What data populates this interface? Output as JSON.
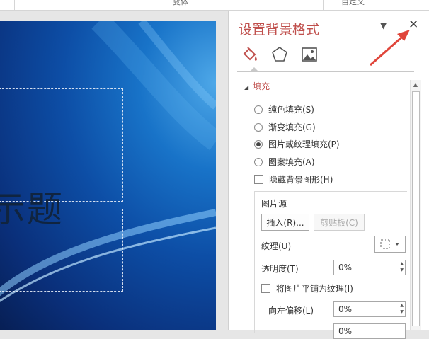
{
  "ribbon": {
    "groups": [
      "变体",
      "自定义"
    ]
  },
  "slide": {
    "title_partial": "示题"
  },
  "pane": {
    "title": "设置背景格式",
    "tabs": [
      "fill-icon",
      "pentagon-icon",
      "picture-icon"
    ],
    "section": "填充",
    "fill_options": [
      {
        "label": "纯色填充(S)",
        "selected": false
      },
      {
        "label": "渐变填充(G)",
        "selected": false
      },
      {
        "label": "图片或纹理填充(P)",
        "selected": true
      },
      {
        "label": "图案填充(A)",
        "selected": false
      }
    ],
    "hide_bg_graphics": "隐藏背景图形(H)",
    "picture_source_label": "图片源",
    "insert_button": "插入(R)...",
    "clipboard_button": "剪贴板(C)",
    "texture_label": "纹理(U)",
    "transparency_label": "透明度(T)",
    "transparency_value": "0%",
    "tile_label": "将图片平铺为纹理(I)",
    "offset_left_label": "向左偏移(L)",
    "offset_left_value": "0%",
    "offset_right_value": "0%"
  },
  "colors": {
    "accent": "#c0504d",
    "arrow": "#e0453a"
  }
}
